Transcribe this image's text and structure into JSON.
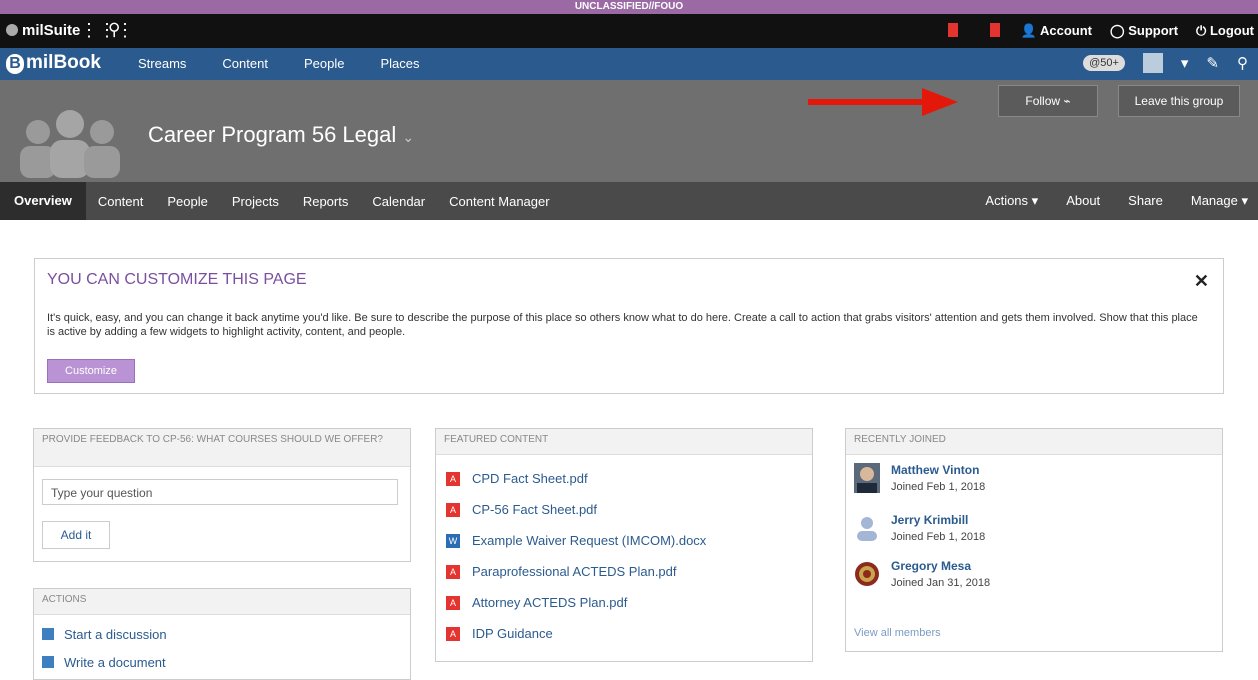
{
  "classification": "UNCLASSIFIED//FOUO",
  "topbar": {
    "brand": "milSuite",
    "account": "Account",
    "support": "Support",
    "logout": "Logout"
  },
  "navbar": {
    "logo": "milBook",
    "links": [
      "Streams",
      "Content",
      "People",
      "Places"
    ],
    "mentions_badge": "@50+"
  },
  "hero": {
    "group_title": "Career Program 56 Legal",
    "follow_label": "Follow",
    "leave_label": "Leave this group"
  },
  "subnav": {
    "left": [
      "Overview",
      "Content",
      "People",
      "Projects",
      "Reports",
      "Calendar",
      "Content Manager"
    ],
    "right": [
      "Actions ▾",
      "About",
      "Share",
      "Manage ▾"
    ]
  },
  "customize": {
    "heading": "YOU CAN CUSTOMIZE THIS PAGE",
    "text": "It's quick, easy, and you can change it back anytime you'd like. Be sure to describe the purpose of this place so others know what to do here. Create a call to action that grabs visitors' attention and gets them involved. Show that this place is active by adding a few widgets to highlight activity, content, and people.",
    "button": "Customize"
  },
  "feedback": {
    "header": "PROVIDE FEEDBACK TO CP-56: WHAT COURSES SHOULD WE OFFER?",
    "placeholder": "Type your question",
    "button": "Add it"
  },
  "actions": {
    "header": "ACTIONS",
    "items": [
      "Start a discussion",
      "Write a document"
    ]
  },
  "featured": {
    "header": "FEATURED CONTENT",
    "items": [
      {
        "title": "CPD Fact Sheet.pdf",
        "type": "pdf"
      },
      {
        "title": "CP-56 Fact Sheet.pdf",
        "type": "pdf"
      },
      {
        "title": "Example Waiver Request (IMCOM).docx",
        "type": "doc"
      },
      {
        "title": "Paraprofessional ACTEDS Plan.pdf",
        "type": "pdf"
      },
      {
        "title": "Attorney ACTEDS Plan.pdf",
        "type": "pdf"
      },
      {
        "title": "IDP Guidance",
        "type": "pdf"
      }
    ]
  },
  "joined": {
    "header": "RECENTLY JOINED",
    "members": [
      {
        "name": "Matthew Vinton",
        "date": "Joined Feb 1, 2018"
      },
      {
        "name": "Jerry Krimbill",
        "date": "Joined Feb 1, 2018"
      },
      {
        "name": "Gregory Mesa",
        "date": "Joined Jan 31, 2018"
      }
    ],
    "view_all": "View all members"
  },
  "colors": {
    "nav_blue": "#2b5b8e",
    "accent_purple": "#7a4f9f",
    "arrow_red": "#e3170a"
  }
}
